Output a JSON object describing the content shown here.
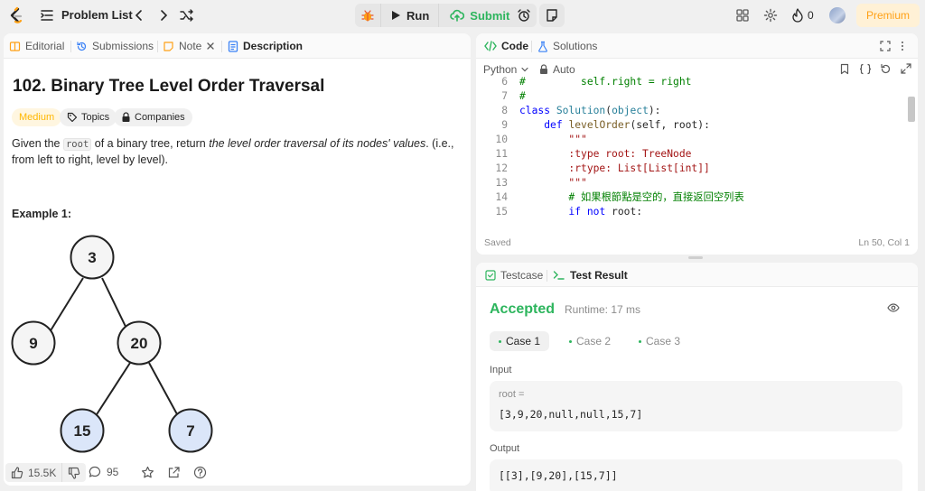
{
  "topbar": {
    "problem_list_label": "Problem List",
    "run_label": "Run",
    "submit_label": "Submit",
    "streak_count": "0",
    "premium_label": "Premium",
    "colors": {
      "brand": "#ffa116",
      "submit": "#2db55d"
    }
  },
  "left_tabs": {
    "editorial": "Editorial",
    "submissions": "Submissions",
    "note": "Note",
    "description": "Description"
  },
  "problem": {
    "title": "102. Binary Tree Level Order Traversal",
    "difficulty": "Medium",
    "topics_label": "Topics",
    "companies_label": "Companies",
    "desc_part1": "Given the ",
    "desc_code": "root",
    "desc_part2": " of a binary tree, return ",
    "desc_italic": "the level order traversal of its nodes' values",
    "desc_part3": ". (i.e., from left to right, level by level).",
    "example_title": "Example 1:",
    "tree_nodes": [
      "3",
      "9",
      "20",
      "15",
      "7"
    ]
  },
  "footer": {
    "likes": "15.5K",
    "comments": "95"
  },
  "code_panel": {
    "code_tab": "Code",
    "solutions_tab": "Solutions",
    "language": "Python",
    "mode": "Auto",
    "saved": "Saved",
    "cursor_pos": "Ln 50, Col 1",
    "lines": [
      {
        "n": "6",
        "text": "#         self.right = right"
      },
      {
        "n": "7",
        "text": "#"
      },
      {
        "n": "8",
        "text": "class Solution(object):"
      },
      {
        "n": "9",
        "text": "    def levelOrder(self, root):"
      },
      {
        "n": "10",
        "text": "        \"\"\""
      },
      {
        "n": "11",
        "text": "        :type root: TreeNode"
      },
      {
        "n": "12",
        "text": "        :rtype: List[List[int]]"
      },
      {
        "n": "13",
        "text": "        \"\"\""
      },
      {
        "n": "14",
        "text": "        # 如果根節點是空的，直接返回空列表"
      },
      {
        "n": "15",
        "text": "        if not root:"
      }
    ]
  },
  "test_panel": {
    "testcase_tab": "Testcase",
    "result_tab": "Test Result",
    "status": "Accepted",
    "runtime": "Runtime: 17 ms",
    "cases": [
      "Case 1",
      "Case 2",
      "Case 3"
    ],
    "input_label": "Input",
    "input_var": "root =",
    "input_value": "[3,9,20,null,null,15,7]",
    "output_label": "Output",
    "output_value": "[[3],[9,20],[15,7]]"
  }
}
